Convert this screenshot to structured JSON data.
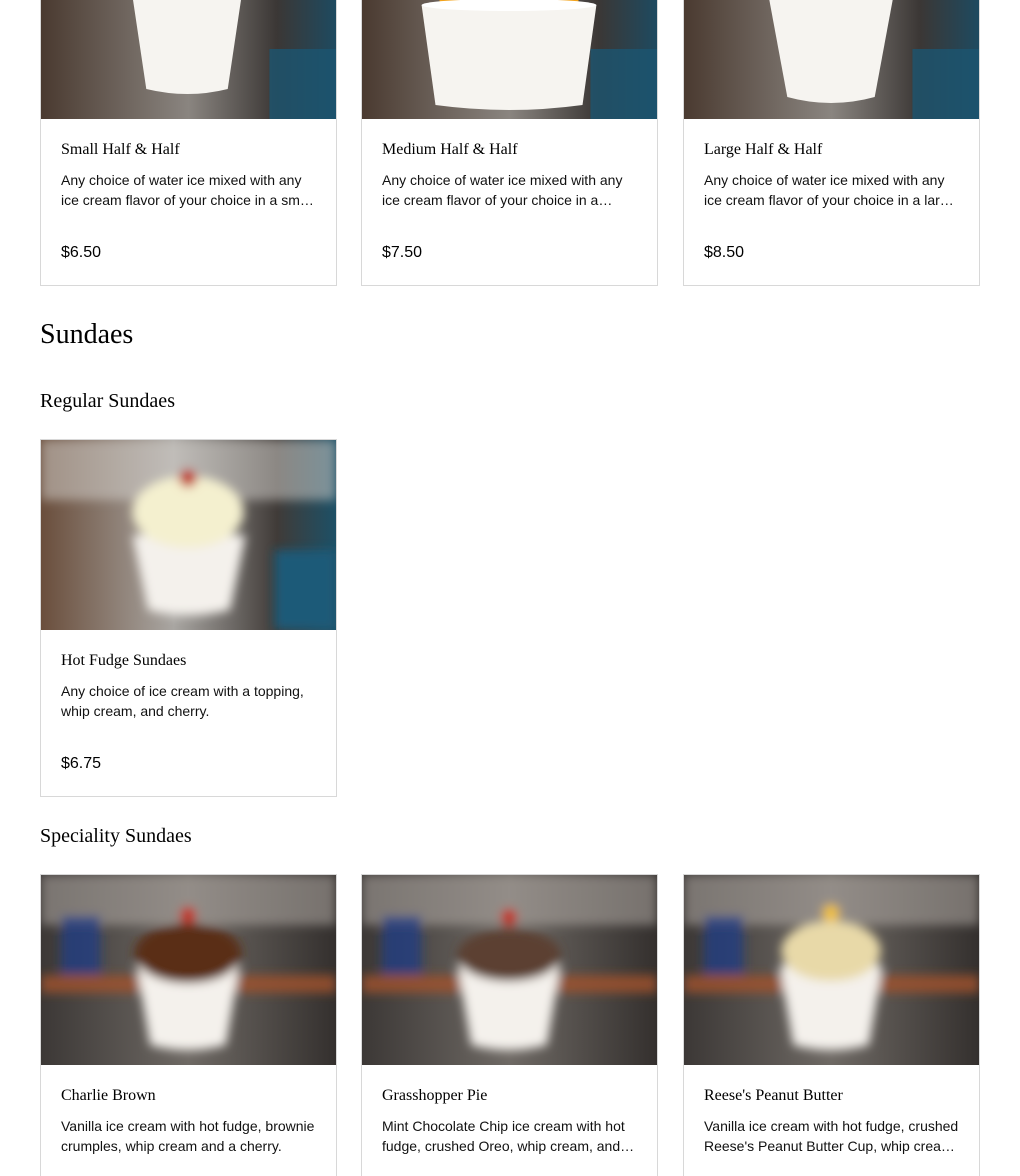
{
  "half_and_half": {
    "items": [
      {
        "name": "Small Half & Half",
        "description": "Any choice of water ice mixed with any ice cream flavor of your choice in a small cup.",
        "price": "$6.50",
        "image": "small-cup-photo"
      },
      {
        "name": "Medium Half & Half",
        "description": "Any choice of water ice mixed with any ice cream flavor of your choice in a medium cup.",
        "price": "$7.50",
        "image": "medium-cup-photo"
      },
      {
        "name": "Large Half & Half",
        "description": "Any choice of water ice mixed with any ice cream flavor of your choice in a large cup.",
        "price": "$8.50",
        "image": "large-cup-photo"
      }
    ]
  },
  "sundaes": {
    "title": "Sundaes",
    "regular": {
      "title": "Regular Sundaes",
      "items": [
        {
          "name": "Hot Fudge Sundaes",
          "description": "Any choice of ice cream with a topping, whip cream, and cherry.",
          "price": "$6.75",
          "image": "hot-fudge-sundae-photo"
        }
      ]
    },
    "speciality": {
      "title": "Speciality Sundaes",
      "items": [
        {
          "name": "Charlie Brown",
          "description": "Vanilla ice cream with hot fudge, brownie crumples, whip cream and a cherry.",
          "image": "charlie-brown-photo"
        },
        {
          "name": "Grasshopper Pie",
          "description": "Mint Chocolate Chip ice cream with hot fudge, crushed Oreo, whip cream, and a cherry.",
          "image": "grasshopper-pie-photo"
        },
        {
          "name": "Reese's Peanut Butter",
          "description": "Vanilla ice cream with hot fudge, crushed Reese's Peanut Butter Cup, whip cream and a cherry.",
          "image": "reeses-peanut-butter-photo"
        }
      ]
    }
  },
  "colors": {
    "card_border": "#d8d8d8",
    "photo_background_dark": "#3a3634",
    "cup_white": "#f4f1ec",
    "water_ice_orange": "#f2a21a",
    "fudge_brown": "#5a2e18",
    "cherry_red": "#c0392b"
  }
}
